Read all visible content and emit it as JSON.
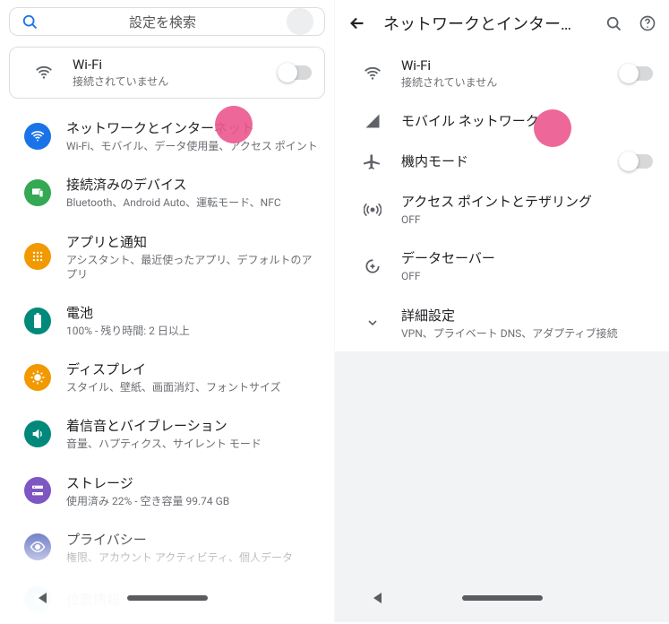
{
  "left": {
    "search_placeholder": "設定を検索",
    "wifi": {
      "title": "Wi-Fi",
      "subtitle": "接続されていません"
    },
    "items": [
      {
        "title": "ネットワークとインターネット",
        "subtitle": "Wi-Fi、モバイル、データ使用量、アクセス ポイント"
      },
      {
        "title": "接続済みのデバイス",
        "subtitle": "Bluetooth、Android Auto、運転モード、NFC"
      },
      {
        "title": "アプリと通知",
        "subtitle": "アシスタント、最近使ったアプリ、デフォルトのアプリ"
      },
      {
        "title": "電池",
        "subtitle": "100% - 残り時間: 2 日以上"
      },
      {
        "title": "ディスプレイ",
        "subtitle": "スタイル、壁紙、画面消灯、フォントサイズ"
      },
      {
        "title": "着信音とバイブレーション",
        "subtitle": "音量、ハプティクス、サイレント モード"
      },
      {
        "title": "ストレージ",
        "subtitle": "使用済み 22% - 空き容量 99.74 GB"
      },
      {
        "title": "プライバシー",
        "subtitle": "権限、アカウント アクティビティ、個人データ"
      },
      {
        "title": "位置情報",
        "subtitle": ""
      }
    ]
  },
  "right": {
    "header_title": "ネットワークとインター…",
    "wifi": {
      "title": "Wi-Fi",
      "subtitle": "接続されていません"
    },
    "items": [
      {
        "title": "モバイル ネットワーク",
        "subtitle": ""
      },
      {
        "title": "機内モード",
        "subtitle": ""
      },
      {
        "title": "アクセス ポイントとテザリング",
        "subtitle": "OFF"
      },
      {
        "title": "データセーバー",
        "subtitle": "OFF"
      },
      {
        "title": "詳細設定",
        "subtitle": "VPN、プライベート DNS、アダプティブ接続"
      }
    ]
  }
}
